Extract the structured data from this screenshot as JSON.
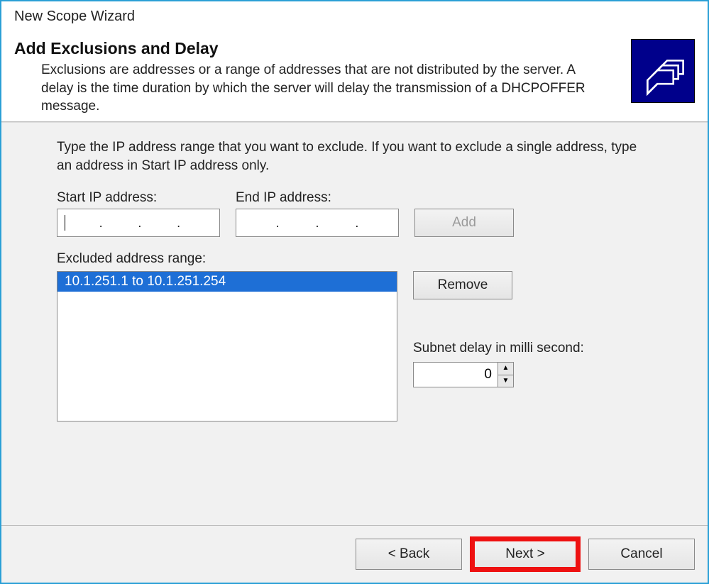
{
  "window": {
    "title": "New Scope Wizard"
  },
  "header": {
    "title": "Add Exclusions and Delay",
    "description": "Exclusions are addresses or a range of addresses that are not distributed by the server. A delay is the time duration by which the server will delay the transmission of a DHCPOFFER message."
  },
  "body": {
    "instruction": "Type the IP address range that you want to exclude. If you want to exclude a single address, type an address in Start IP address only.",
    "start_ip": {
      "label": "Start IP address:",
      "value": ""
    },
    "end_ip": {
      "label": "End IP address:",
      "value": ""
    },
    "add_button": "Add",
    "excluded": {
      "label": "Excluded address range:",
      "items": [
        "10.1.251.1 to 10.1.251.254"
      ],
      "selected_index": 0
    },
    "remove_button": "Remove",
    "delay": {
      "label": "Subnet delay in milli second:",
      "value": "0"
    }
  },
  "footer": {
    "back": "< Back",
    "next": "Next >",
    "cancel": "Cancel"
  },
  "icon_name": "books-folder-icon"
}
